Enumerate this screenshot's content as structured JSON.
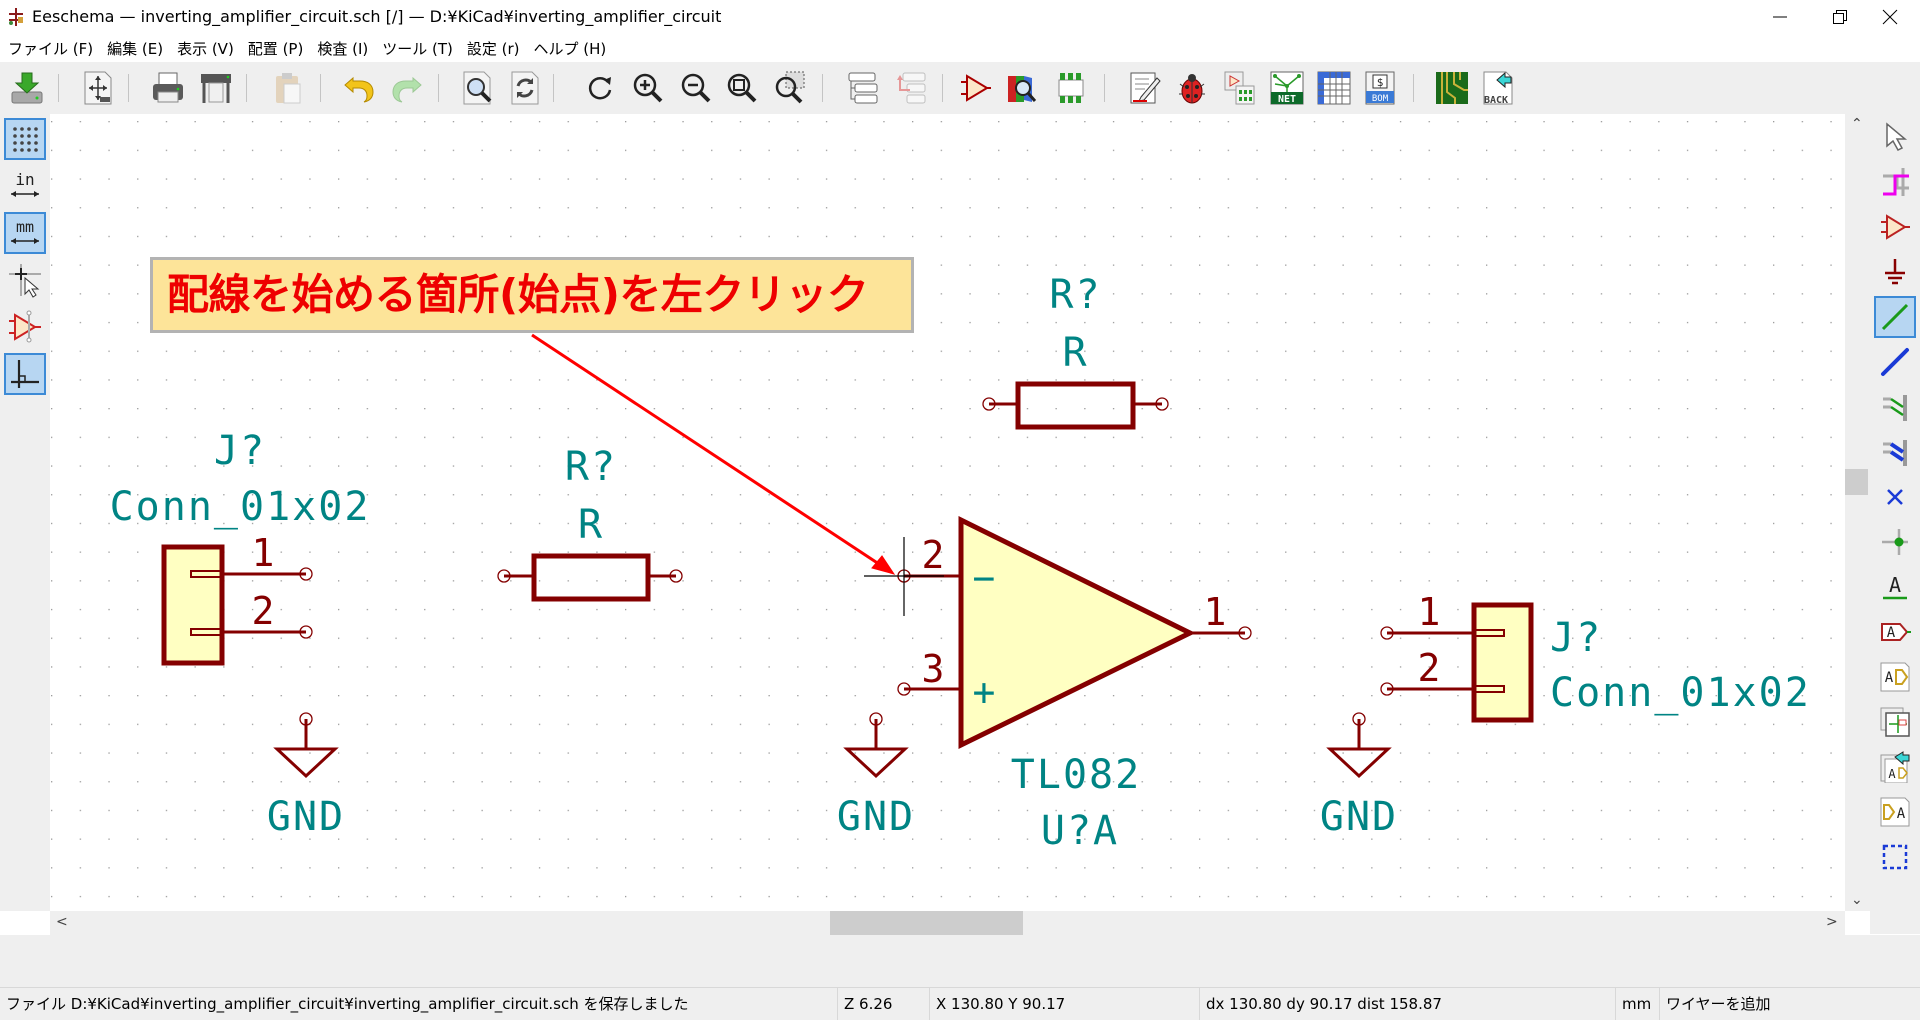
{
  "window": {
    "title": "Eeschema — inverting_amplifier_circuit.sch [/] — D:¥KiCad¥inverting_amplifier_circuit",
    "controls": [
      "minimize",
      "restore",
      "close"
    ]
  },
  "menu": {
    "items": [
      {
        "label": "ファイル (F)"
      },
      {
        "label": "編集 (E)"
      },
      {
        "label": "表示 (V)"
      },
      {
        "label": "配置 (P)"
      },
      {
        "label": "検査 (I)"
      },
      {
        "label": "ツール (T)"
      },
      {
        "label": "設定 (r)"
      },
      {
        "label": "ヘルプ (H)"
      }
    ]
  },
  "toolbar": {
    "items": [
      "save-icon",
      "page-settings-icon",
      "print-icon",
      "plot-icon",
      "paste-icon",
      "undo-icon",
      "redo-icon",
      "find-icon",
      "find-replace-icon",
      "redraw-icon",
      "zoom-in-icon",
      "zoom-out-icon",
      "zoom-fit-icon",
      "zoom-selection-icon",
      "hierarchy-navigator-icon",
      "leave-sheet-icon",
      "symbol-editor-icon",
      "symbol-browser-icon",
      "footprint-editor-icon",
      "annotate-icon",
      "erc-icon",
      "assign-footprints-icon",
      "netlist-icon",
      "bulk-edit-fields-icon",
      "bom-icon",
      "pcbnew-icon",
      "back-annotate-icon"
    ],
    "netlist_label": "NET",
    "bom_label": "BOM",
    "back_label": "BACK"
  },
  "left_toolbar": {
    "items": [
      {
        "name": "grid-toggle",
        "active": true
      },
      {
        "name": "units-inch",
        "label": "in",
        "active": false
      },
      {
        "name": "units-mm",
        "label": "mm",
        "active": true
      },
      {
        "name": "fullscreen-cursor",
        "active": false
      },
      {
        "name": "hidden-pins",
        "active": false
      },
      {
        "name": "wire-45-mode",
        "active": true
      }
    ]
  },
  "right_toolbar": {
    "items": [
      {
        "name": "select-tool",
        "active": false
      },
      {
        "name": "highlight-net-tool",
        "active": false
      },
      {
        "name": "add-symbol-tool",
        "active": false
      },
      {
        "name": "add-power-tool",
        "active": false
      },
      {
        "name": "add-wire-tool",
        "active": true
      },
      {
        "name": "add-bus-tool",
        "active": false
      },
      {
        "name": "wire-bus-entry-tool",
        "active": false
      },
      {
        "name": "bus-bus-entry-tool",
        "active": false
      },
      {
        "name": "no-connect-tool",
        "active": false
      },
      {
        "name": "junction-tool",
        "active": false
      },
      {
        "name": "net-label-tool",
        "active": false
      },
      {
        "name": "global-label-tool",
        "active": false
      },
      {
        "name": "hier-label-tool",
        "active": false
      },
      {
        "name": "hier-sheet-tool",
        "active": false
      },
      {
        "name": "import-sheet-pin-tool",
        "active": false
      },
      {
        "name": "sheet-pin-tool",
        "active": false
      },
      {
        "name": "graphic-lines-tool",
        "active": false
      }
    ],
    "text_glyph": "A"
  },
  "schematic": {
    "annotation": "配線を始める箇所(始点)を左クリック",
    "components": {
      "conn_left": {
        "ref": "J?",
        "value": "Conn_01x02",
        "pins": [
          "1",
          "2"
        ]
      },
      "r_left": {
        "ref": "R?",
        "value": "R"
      },
      "r_top": {
        "ref": "R?",
        "value": "R"
      },
      "opamp": {
        "ref": "U?A",
        "value": "TL082",
        "pin_inv": "2",
        "pin_noninv": "3",
        "pin_out": "1",
        "sign_minus": "−",
        "sign_plus": "+"
      },
      "conn_right": {
        "ref": "J?",
        "value": "Conn_01x02",
        "pins": [
          "1",
          "2"
        ]
      },
      "gnd1": {
        "label": "GND"
      },
      "gnd2": {
        "label": "GND"
      },
      "gnd3": {
        "label": "GND"
      }
    },
    "colors": {
      "body": "#840000",
      "fill": "#ffffc2",
      "text": "#008484",
      "annotation_text": "#ee0000",
      "annotation_bg": "#fde499",
      "arrow": "#ff0000",
      "grid": "#9a9a9a"
    }
  },
  "scroll": {
    "left_arrow": "<",
    "right_arrow": ">",
    "up_arrow": "^",
    "down_arrow": "v"
  },
  "status": {
    "message": "ファイル D:¥KiCad¥inverting_amplifier_circuit¥inverting_amplifier_circuit.sch を保存しました",
    "zoom": "Z 6.26",
    "xy": "X 130.80  Y 90.17",
    "delta": "dx 130.80  dy 90.17  dist 158.87",
    "units": "mm",
    "mode": "ワイヤーを追加"
  }
}
